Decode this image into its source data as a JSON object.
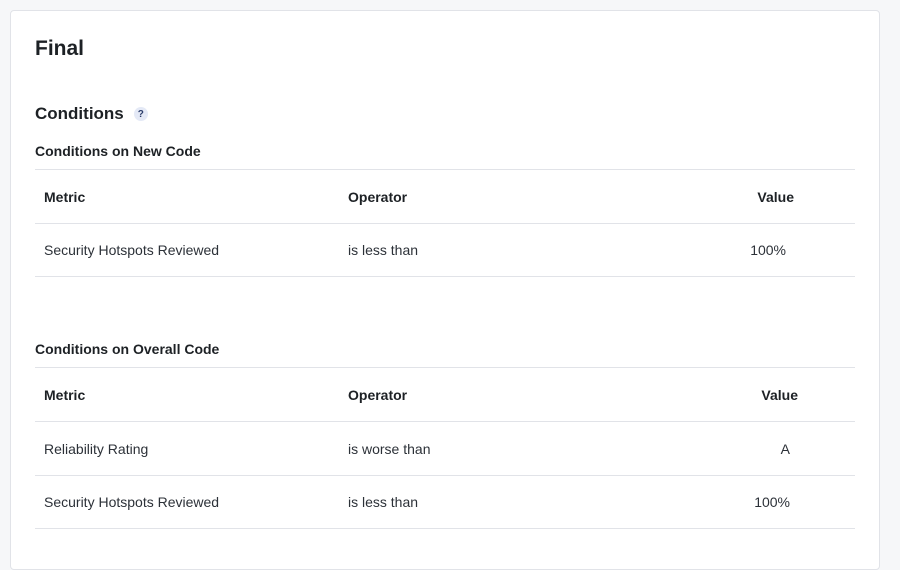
{
  "card": {
    "title": "Final"
  },
  "conditions": {
    "title": "Conditions",
    "help_icon": "?"
  },
  "new_code": {
    "title": "Conditions on New Code",
    "headers": {
      "metric": "Metric",
      "operator": "Operator",
      "value": "Value"
    },
    "rows": [
      {
        "metric": "Security Hotspots Reviewed",
        "operator": "is less than",
        "value": "100%"
      }
    ]
  },
  "overall_code": {
    "title": "Conditions on Overall Code",
    "headers": {
      "metric": "Metric",
      "operator": "Operator",
      "value": "Value"
    },
    "rows": [
      {
        "metric": "Reliability Rating",
        "operator": "is worse than",
        "value": "A"
      },
      {
        "metric": "Security Hotspots Reviewed",
        "operator": "is less than",
        "value": "100%"
      }
    ]
  }
}
